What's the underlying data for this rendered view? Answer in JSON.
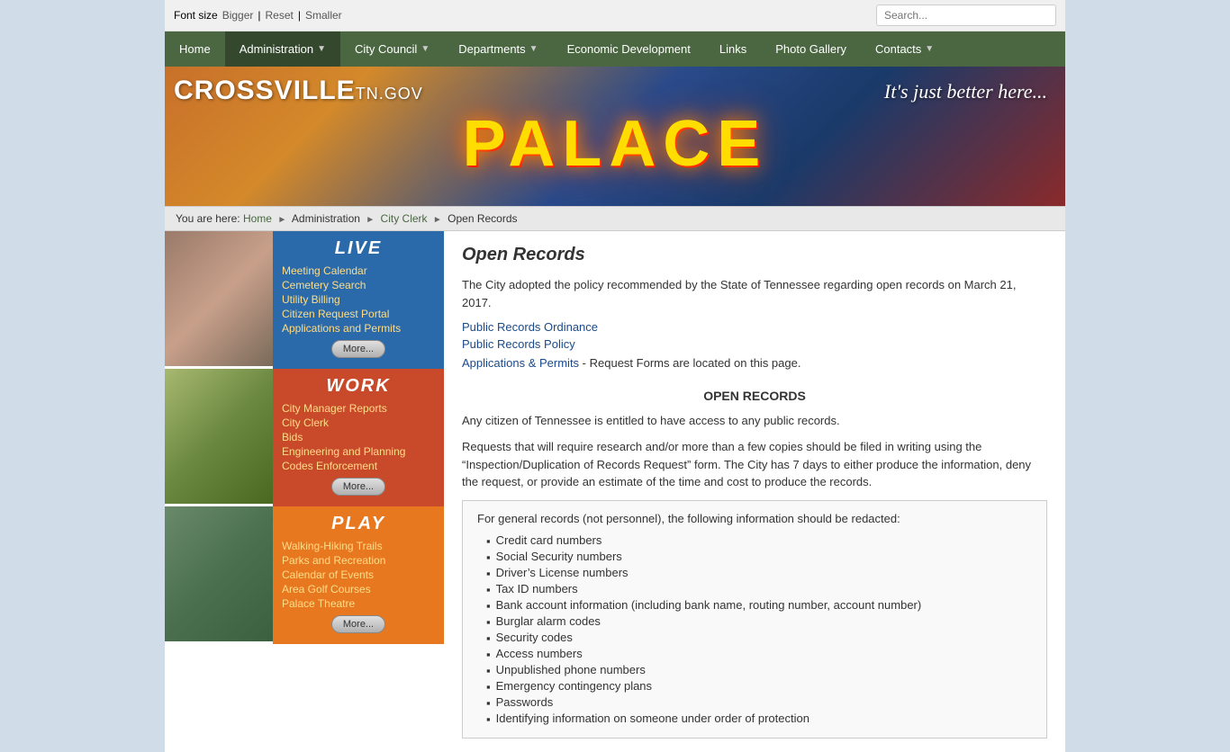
{
  "topbar": {
    "font_size_label": "Font size",
    "bigger": "Bigger",
    "reset": "Reset",
    "smaller": "Smaller",
    "search_placeholder": "Search..."
  },
  "nav": {
    "items": [
      {
        "label": "Home",
        "active": false
      },
      {
        "label": "Administration",
        "has_arrow": true,
        "active": true
      },
      {
        "label": "City Council",
        "has_arrow": true,
        "active": false
      },
      {
        "label": "Departments",
        "has_arrow": true,
        "active": false
      },
      {
        "label": "Economic Development",
        "has_arrow": false,
        "active": false
      },
      {
        "label": "Links",
        "has_arrow": false,
        "active": false
      },
      {
        "label": "Photo Gallery",
        "has_arrow": false,
        "active": false
      },
      {
        "label": "Contacts",
        "has_arrow": true,
        "active": false
      }
    ]
  },
  "header": {
    "site_name_part1": "CROSSVILLE",
    "site_name_part2": "TN.GOV",
    "tagline": "It's just better here...",
    "palace_text": "PALACE"
  },
  "breadcrumb": {
    "you_are_here": "You are here:",
    "home": "Home",
    "administration": "Administration",
    "city_clerk": "City Clerk",
    "current": "Open Records"
  },
  "sidebar": {
    "live": {
      "title": "LIVE",
      "links": [
        "Meeting Calendar",
        "Cemetery Search",
        "Utility Billing",
        "Citizen Request Portal",
        "Applications and Permits"
      ],
      "more": "More..."
    },
    "work": {
      "title": "WORK",
      "links": [
        "City Manager Reports",
        "City Clerk",
        "Bids",
        "Engineering and Planning",
        "Codes Enforcement"
      ],
      "more": "More..."
    },
    "play": {
      "title": "PLAY",
      "links": [
        "Walking-Hiking Trails",
        "Parks and Recreation",
        "Calendar of Events",
        "Area Golf Courses",
        "Palace Theatre"
      ],
      "more": "More..."
    }
  },
  "main": {
    "page_title": "Open Records",
    "intro_text": "The City adopted the policy recommended by the State of Tennessee regarding open records on March 21, 2017.",
    "link1": "Public Records Ordinance",
    "link2": "Public Records Policy",
    "link3_text": "Applications & Permits",
    "link3_suffix": " - Request Forms are located on this page.",
    "section_title": "OPEN RECORDS",
    "para1": "Any citizen of Tennessee is entitled to have access to any public records.",
    "para2": "Requests that will require research and/or more than a few copies should be filed in writing using the “Inspection/Duplication of Records Request” form. The City has 7 days to either produce the information, deny the request, or provide an estimate of the time and cost to produce the records.",
    "redact_intro": "For general records (not personnel), the following information should be redacted:",
    "redact_items": [
      "Credit card numbers",
      "Social Security numbers",
      "Driver’s License numbers",
      "Tax ID numbers",
      "Bank account information (including bank name, routing number, account number)",
      "Burglar alarm codes",
      "Security codes",
      "Access numbers",
      "Unpublished phone numbers",
      "Emergency contingency plans",
      "Passwords",
      "Identifying information on someone under order of protection"
    ]
  }
}
